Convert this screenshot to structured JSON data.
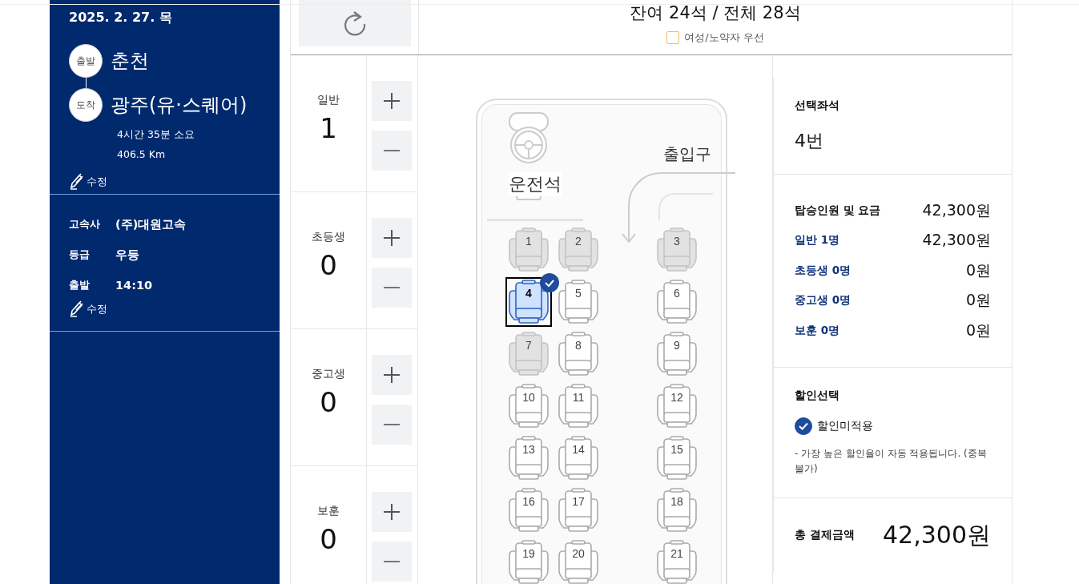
{
  "trip": {
    "date": "2025. 2. 27. 목",
    "stops": [
      {
        "tag": "출발",
        "name": "춘천"
      },
      {
        "tag": "도착",
        "name": "광주(유·스퀘어)"
      }
    ],
    "duration": "4시간 35분 소요",
    "distance": "406.5 Km",
    "edit_label": "수정"
  },
  "details": {
    "rows": [
      {
        "label": "고속사",
        "value": "(주)대원고속"
      },
      {
        "label": "등급",
        "value": "우등"
      },
      {
        "label": "출발",
        "value": "14:10"
      }
    ],
    "edit_label": "수정"
  },
  "seat_header": {
    "title": "잔여 24석 / 전체 28석",
    "priority": {
      "label": "여성/노약자 우선",
      "checked": false
    }
  },
  "passengers": [
    {
      "label": "일반",
      "count": "1"
    },
    {
      "label": "초등생",
      "count": "0"
    },
    {
      "label": "중고생",
      "count": "0"
    },
    {
      "label": "보훈",
      "count": "0"
    }
  ],
  "bus": {
    "driver_label": "운전석",
    "entrance_label": "출입구",
    "seats": [
      {
        "number": "1",
        "taken": true,
        "selected": false
      },
      {
        "number": "2",
        "taken": true,
        "selected": false
      },
      {
        "number": "3",
        "taken": true,
        "selected": false
      },
      {
        "number": "4",
        "taken": false,
        "selected": true
      },
      {
        "number": "5",
        "taken": false,
        "selected": false
      },
      {
        "number": "6",
        "taken": false,
        "selected": false
      },
      {
        "number": "7",
        "taken": true,
        "selected": false
      },
      {
        "number": "8",
        "taken": false,
        "selected": false
      },
      {
        "number": "9",
        "taken": false,
        "selected": false
      },
      {
        "number": "10",
        "taken": false,
        "selected": false
      },
      {
        "number": "11",
        "taken": false,
        "selected": false
      },
      {
        "number": "12",
        "taken": false,
        "selected": false
      },
      {
        "number": "13",
        "taken": false,
        "selected": false
      },
      {
        "number": "14",
        "taken": false,
        "selected": false
      },
      {
        "number": "15",
        "taken": false,
        "selected": false
      },
      {
        "number": "16",
        "taken": false,
        "selected": false
      },
      {
        "number": "17",
        "taken": false,
        "selected": false
      },
      {
        "number": "18",
        "taken": false,
        "selected": false
      },
      {
        "number": "19",
        "taken": false,
        "selected": false
      },
      {
        "number": "20",
        "taken": false,
        "selected": false
      },
      {
        "number": "21",
        "taken": false,
        "selected": false
      }
    ]
  },
  "summary": {
    "selected_seat": {
      "label": "선택좌석",
      "value": "4번"
    },
    "fares": {
      "label": "탑승인원 및 요금",
      "total": "42,300원",
      "rows": [
        {
          "label": "일반 1명",
          "amount": "42,300원"
        },
        {
          "label": "초등생 0명",
          "amount": "0원"
        },
        {
          "label": "중고생 0명",
          "amount": "0원"
        },
        {
          "label": "보훈 0명",
          "amount": "0원"
        }
      ]
    },
    "discount": {
      "label": "할인선택",
      "option": {
        "label": "할인미적용",
        "checked": true
      },
      "note": "- 가장 높은 할인율이 자동 적용됩니다. (중복불가)"
    },
    "total": {
      "label": "총 결제금액",
      "amount": "42,300원"
    }
  }
}
